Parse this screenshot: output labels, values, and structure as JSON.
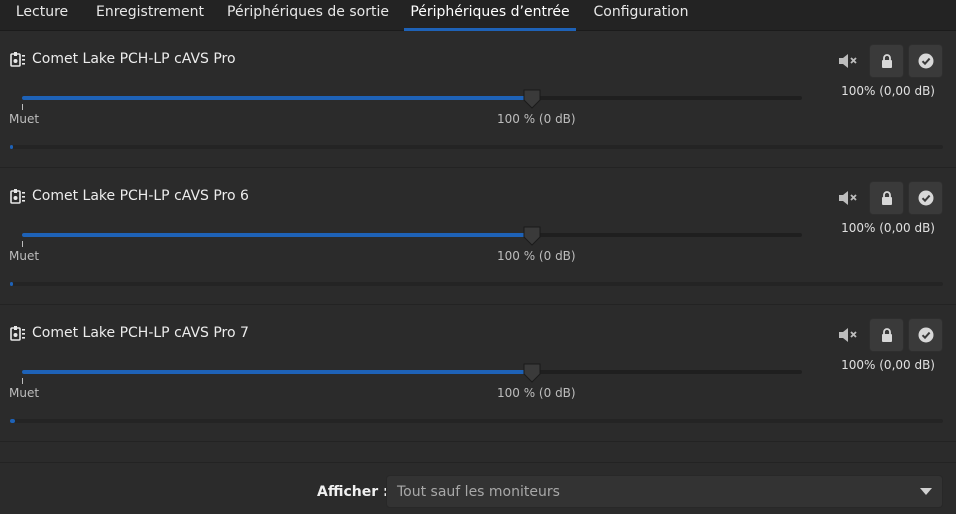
{
  "tabs": [
    {
      "label": "Lecture",
      "active": false
    },
    {
      "label": "Enregistrement",
      "active": false
    },
    {
      "label": "Périphériques de sortie",
      "active": false
    },
    {
      "label": "Périphériques d’entrée",
      "active": true
    },
    {
      "label": "Configuration",
      "active": false
    }
  ],
  "devices": [
    {
      "name": "Comet Lake PCH-LP cAVS Pro",
      "volume_readout": "100% (0,00 dB)",
      "volume_fraction": 0.653,
      "level_fraction": 0.003,
      "scale": {
        "mute_label": "Muet",
        "hundred_label": "100 % (0 dB)"
      }
    },
    {
      "name": "Comet Lake PCH-LP cAVS Pro 6",
      "volume_readout": "100% (0,00 dB)",
      "volume_fraction": 0.653,
      "level_fraction": 0.003,
      "scale": {
        "mute_label": "Muet",
        "hundred_label": "100 % (0 dB)"
      }
    },
    {
      "name": "Comet Lake PCH-LP cAVS Pro 7",
      "volume_readout": "100% (0,00 dB)",
      "volume_fraction": 0.653,
      "level_fraction": 0.005,
      "scale": {
        "mute_label": "Muet",
        "hundred_label": "100 % (0 dB)"
      }
    }
  ],
  "footer": {
    "show_label": "Afficher :",
    "show_value": "Tout sauf les moniteurs"
  },
  "icons": {
    "device": "audio-card-icon",
    "mute": "speaker-muted-icon",
    "lock": "lock-icon",
    "default": "checkmark-icon",
    "dropdown": "chevron-down-icon"
  },
  "colors": {
    "accent": "#1e62b7",
    "background": "#2b2b2b",
    "tabbar": "#232323"
  }
}
